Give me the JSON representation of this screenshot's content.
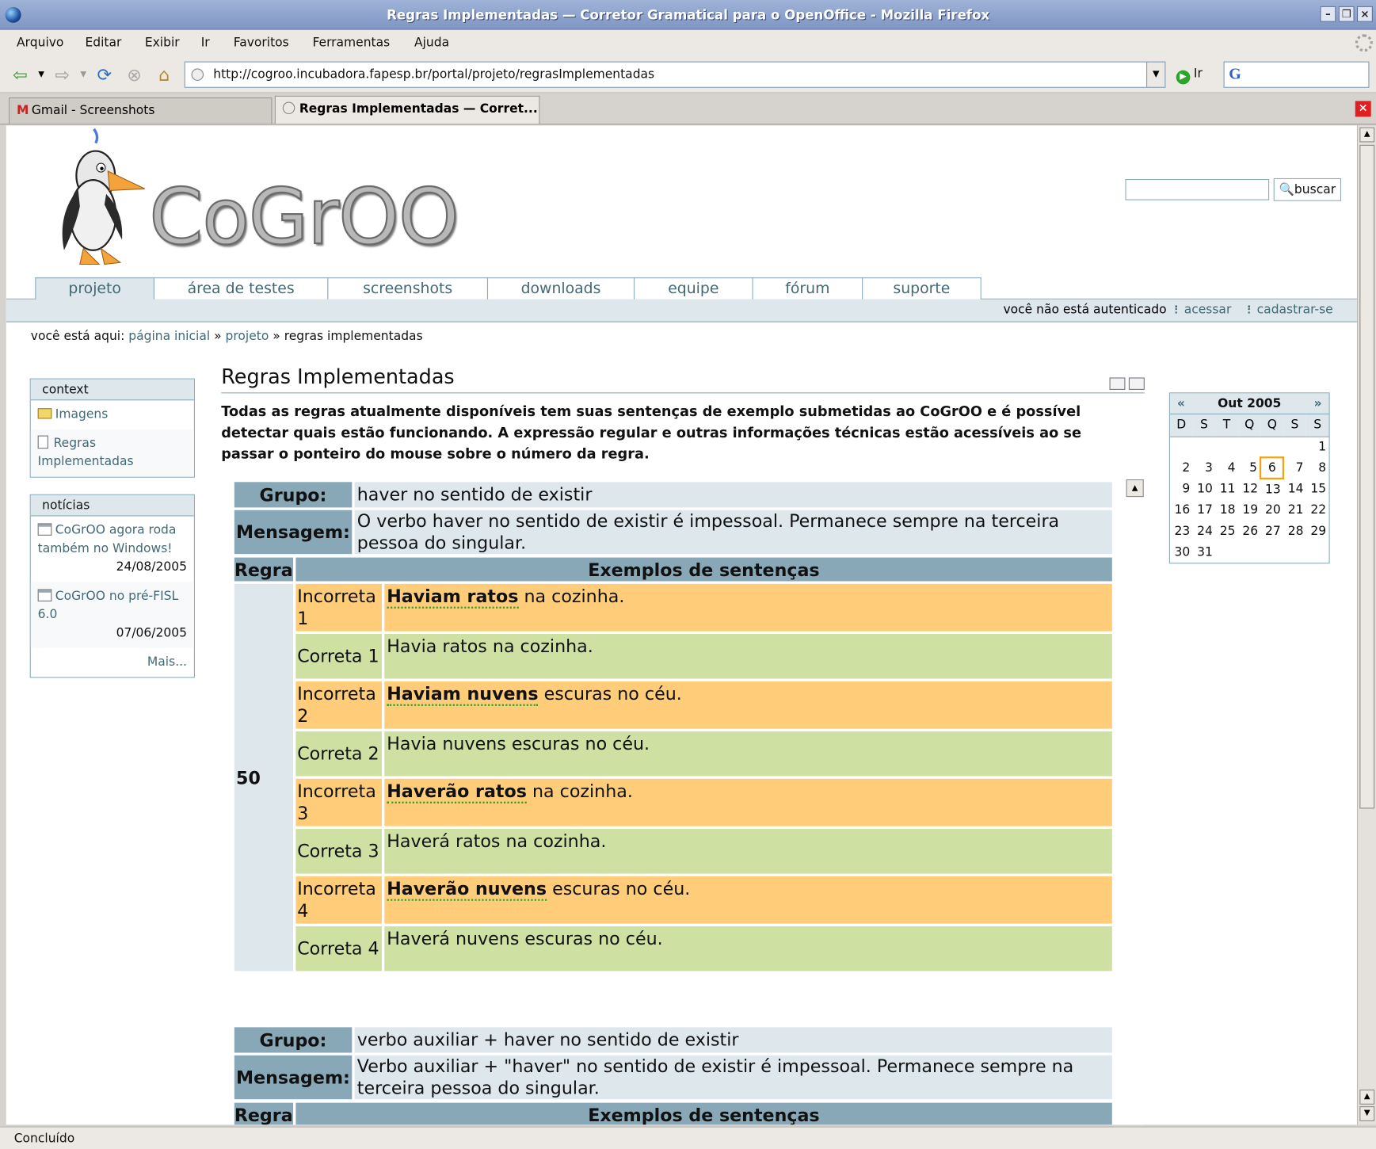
{
  "window": {
    "title": "Regras Implementadas — Corretor Gramatical para o OpenOffice - Mozilla Firefox"
  },
  "menu": [
    "Arquivo",
    "Editar",
    "Exibir",
    "Ir",
    "Favoritos",
    "Ferramentas",
    "Ajuda"
  ],
  "navbar": {
    "url": "http://cogroo.incubadora.fapesp.br/portal/projeto/regrasImplementadas",
    "go_label": "Ir",
    "search_engine": "G"
  },
  "tabs": [
    {
      "label": "Gmail - Screenshots",
      "icon": "gmail-icon"
    },
    {
      "label": "Regras Implementadas — Corret...",
      "icon": "page-icon"
    }
  ],
  "site": {
    "logo_text": "CoGrOO",
    "search_button": "buscar",
    "search_value": "",
    "nav_tabs": [
      "projeto",
      "área de testes",
      "screenshots",
      "downloads",
      "equipe",
      "fórum",
      "suporte"
    ],
    "auth_status": "você não está autenticado",
    "login_link": "acessar",
    "register_link": "cadastrar-se"
  },
  "breadcrumb": {
    "prefix": "você está aqui:",
    "home": "página inicial",
    "sep": "»",
    "section": "projeto",
    "current": "regras implementadas"
  },
  "context_portlet": {
    "header": "context",
    "items": [
      "Imagens",
      "Regras Implementadas"
    ]
  },
  "news_portlet": {
    "header": "notícias",
    "items": [
      {
        "title": "CoGrOO agora roda também no Windows!",
        "date": "24/08/2005"
      },
      {
        "title": "CoGrOO no pré-FISL 6.0",
        "date": "07/06/2005"
      }
    ],
    "more": "Mais..."
  },
  "content": {
    "title": "Regras Implementadas",
    "description": "Todas as regras atualmente disponíveis tem suas sentenças de exemplo submetidas ao CoGrOO e é possível detectar quais estão funcionando. A expressão regular e outras informações técnicas estão acessíveis ao se passar o ponteiro do mouse sobre o número da regra."
  },
  "calendar": {
    "prev": "«",
    "next": "»",
    "month": "Out 2005",
    "weekdays": [
      "D",
      "S",
      "T",
      "Q",
      "Q",
      "S",
      "S"
    ],
    "weeks": [
      [
        "",
        "",
        "",
        "",
        "",
        "",
        "1"
      ],
      [
        "2",
        "3",
        "4",
        "5",
        "6",
        "7",
        "8"
      ],
      [
        "9",
        "10",
        "11",
        "12",
        "13",
        "14",
        "15"
      ],
      [
        "16",
        "17",
        "18",
        "19",
        "20",
        "21",
        "22"
      ],
      [
        "23",
        "24",
        "25",
        "26",
        "27",
        "28",
        "29"
      ],
      [
        "30",
        "31",
        "",
        "",
        "",
        "",
        ""
      ]
    ],
    "today": "6"
  },
  "rules": {
    "group_label": "Grupo:",
    "message_label": "Mensagem:",
    "rule_header": "Regra",
    "examples_header": "Exemplos de sentenças",
    "r1": {
      "group": "haver no sentido de existir",
      "message": "O verbo haver no sentido de existir é impessoal. Permanece sempre na terceira pessoa do singular.",
      "number": "50",
      "examples": [
        {
          "kind": "Incorreta 1",
          "error": "Haviam ratos",
          "rest": " na cozinha."
        },
        {
          "kind": "Correta 1",
          "text": "Havia ratos na cozinha."
        },
        {
          "kind": "Incorreta 2",
          "error": "Haviam nuvens",
          "rest": " escuras no céu."
        },
        {
          "kind": "Correta 2",
          "text": "Havia nuvens escuras no céu."
        },
        {
          "kind": "Incorreta 3",
          "error": "Haverão ratos",
          "rest": " na cozinha."
        },
        {
          "kind": "Correta 3",
          "text": "Haverá ratos na cozinha."
        },
        {
          "kind": "Incorreta 4",
          "error": "Haverão nuvens",
          "rest": " escuras no céu."
        },
        {
          "kind": "Correta 4",
          "text": "Haverá nuvens escuras no céu."
        }
      ]
    },
    "r2": {
      "group": "verbo auxiliar + haver no sentido de existir",
      "message": "Verbo auxiliar + \"haver\" no sentido de existir é impessoal. Permanece sempre na terceira pessoa do singular."
    }
  },
  "status": "Concluído"
}
